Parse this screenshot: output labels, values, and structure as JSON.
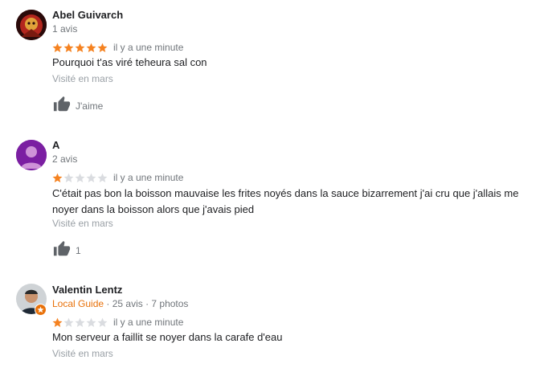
{
  "colors": {
    "star_filled": "#f58220",
    "star_empty": "#dadce0",
    "local_guide": "#e8710a"
  },
  "reviews": [
    {
      "author": "Abel Guivarch",
      "stats": "1 avis",
      "rating": 5,
      "time": "il y a une minute",
      "text": "Pourquoi t'as viré teheura sal con",
      "visited": "Visité en mars",
      "like_label": "J'aime"
    },
    {
      "author": "A",
      "avatar_letter": "",
      "stats": "2 avis",
      "rating": 1,
      "time": "il y a une minute",
      "text": "C'était pas bon la boisson mauvaise les frites noyés dans la sauce bizarrement j'ai cru que j'allais me noyer dans la boisson alors que j'avais pied",
      "visited": "Visité en mars",
      "like_label": "1"
    },
    {
      "author": "Valentin Lentz",
      "local_guide": "Local Guide",
      "stats": " · 25 avis · 7 photos",
      "rating": 1,
      "time": "il y a une minute",
      "text": "Mon serveur a faillit se noyer dans la carafe d'eau",
      "visited": "Visité en mars"
    }
  ]
}
